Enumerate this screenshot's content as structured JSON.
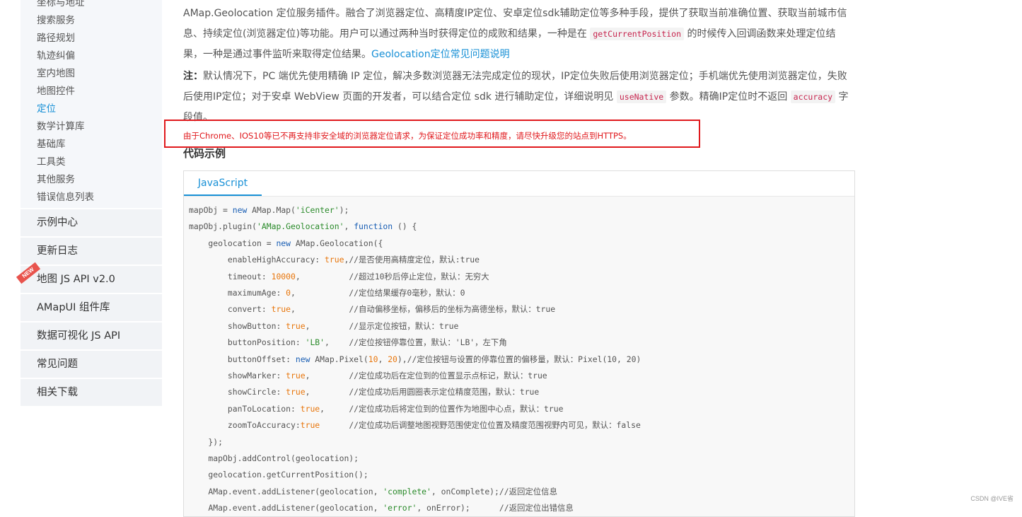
{
  "sidebar": {
    "sub_items": [
      {
        "label": "坐标与地址"
      },
      {
        "label": "搜索服务"
      },
      {
        "label": "路径规划"
      },
      {
        "label": "轨迹纠偏"
      },
      {
        "label": "室内地图"
      },
      {
        "label": "地图控件"
      },
      {
        "label": "定位",
        "active": true
      },
      {
        "label": "数学计算库"
      },
      {
        "label": "基础库"
      },
      {
        "label": "工具类"
      },
      {
        "label": "其他服务"
      },
      {
        "label": "错误信息列表"
      }
    ],
    "nav_items": [
      {
        "label": "示例中心"
      },
      {
        "label": "更新日志"
      },
      {
        "label": "地图 JS API v2.0",
        "badge": "NEW"
      },
      {
        "label": "AMapUI 组件库"
      },
      {
        "label": "数据可视化 JS API"
      },
      {
        "label": "常见问题"
      },
      {
        "label": "相关下载"
      }
    ]
  },
  "intro": {
    "text1": "AMap.Geolocation 定位服务插件。融合了浏览器定位、高精度IP定位、安卓定位sdk辅助定位等多种手段，提供了获取当前准确位置、获取当前城市信息、持续定位(浏览器定位)等功能。用户可以通过两种当时获得定位的成败和结果，一种是在 ",
    "code1": "getCurrentPosition",
    "text2": " 的时候传入回调函数来处理定位结果，一种是通过事件监听来取得定位结果。",
    "link": "Geolocation定位常见问题说明"
  },
  "note": {
    "label": "注：",
    "text1": "默认情况下，PC 端优先使用精确 IP 定位，解决多数浏览器无法完成定位的现状，IP定位失败后使用浏览器定位；手机端优先使用浏览器定位，失败后使用IP定位；对于安卓 WebView 页面的开发者，可以结合定位 sdk 进行辅助定位，详细说明见 ",
    "code1": "useNative",
    "text2": " 参数。精确IP定位时不返回 ",
    "code2": "accuracy",
    "text3": " 字段值。"
  },
  "warning": "由于Chrome、IOS10等已不再支持非安全域的浏览器定位请求，为保证定位成功率和精度，请尽快升级您的站点到HTTPS。",
  "section_title": "代码示例",
  "code_tab": "JavaScript",
  "code_lines": [
    [
      [
        "mapObj = "
      ],
      [
        "new",
        "kw"
      ],
      [
        " AMap.Map("
      ],
      [
        "'iCenter'",
        "str"
      ],
      [
        ");"
      ]
    ],
    [
      [
        "mapObj.plugin("
      ],
      [
        "'AMap.Geolocation'",
        "str"
      ],
      [
        ", "
      ],
      [
        "function",
        "kw"
      ],
      [
        " () {"
      ]
    ],
    [
      [
        "    geolocation = "
      ],
      [
        "new",
        "kw"
      ],
      [
        " AMap.Geolocation({"
      ]
    ],
    [
      [
        "        enableHighAccuracy: "
      ],
      [
        "true",
        "num"
      ],
      [
        ",//是否使用高精度定位，默认:true"
      ]
    ],
    [
      [
        "        timeout: "
      ],
      [
        "10000",
        "num"
      ],
      [
        ",          //超过10秒后停止定位，默认：无穷大"
      ]
    ],
    [
      [
        "        maximumAge: "
      ],
      [
        "0",
        "num"
      ],
      [
        ",           //定位结果缓存0毫秒，默认：0"
      ]
    ],
    [
      [
        "        convert: "
      ],
      [
        "true",
        "num"
      ],
      [
        ",           //自动偏移坐标，偏移后的坐标为高德坐标，默认：true"
      ]
    ],
    [
      [
        "        showButton: "
      ],
      [
        "true",
        "num"
      ],
      [
        ",        //显示定位按钮，默认：true"
      ]
    ],
    [
      [
        "        buttonPosition: "
      ],
      [
        "'LB'",
        "str"
      ],
      [
        ",    //定位按钮停靠位置，默认：'LB'，左下角"
      ]
    ],
    [
      [
        "        buttonOffset: "
      ],
      [
        "new",
        "kw"
      ],
      [
        " AMap.Pixel("
      ],
      [
        "10",
        "num"
      ],
      [
        ", "
      ],
      [
        "20",
        "num"
      ],
      [
        "),//定位按钮与设置的停靠位置的偏移量，默认：Pixel(10, 20)"
      ]
    ],
    [
      [
        "        showMarker: "
      ],
      [
        "true",
        "num"
      ],
      [
        ",        //定位成功后在定位到的位置显示点标记，默认：true"
      ]
    ],
    [
      [
        "        showCircle: "
      ],
      [
        "true",
        "num"
      ],
      [
        ",        //定位成功后用圆圈表示定位精度范围，默认：true"
      ]
    ],
    [
      [
        "        panToLocation: "
      ],
      [
        "true",
        "num"
      ],
      [
        ",     //定位成功后将定位到的位置作为地图中心点，默认：true"
      ]
    ],
    [
      [
        "        zoomToAccuracy:"
      ],
      [
        "true",
        "num"
      ],
      [
        "      //定位成功后调整地图视野范围使定位位置及精度范围视野内可见，默认：false"
      ]
    ],
    [
      [
        "    });"
      ]
    ],
    [
      [
        "    mapObj.addControl(geolocation);"
      ]
    ],
    [
      [
        "    geolocation.getCurrentPosition();"
      ]
    ],
    [
      [
        "    AMap.event.addListener(geolocation, "
      ],
      [
        "'complete'",
        "str"
      ],
      [
        ", onComplete);//返回定位信息"
      ]
    ],
    [
      [
        "    AMap.event.addListener(geolocation, "
      ],
      [
        "'error'",
        "str"
      ],
      [
        ", onError);      //返回定位出错信息"
      ]
    ]
  ],
  "watermark": "CSDN @IVE省",
  "colors": {
    "accent": "#1890d6",
    "warning": "#e0191d",
    "badge": "#e8534d"
  }
}
